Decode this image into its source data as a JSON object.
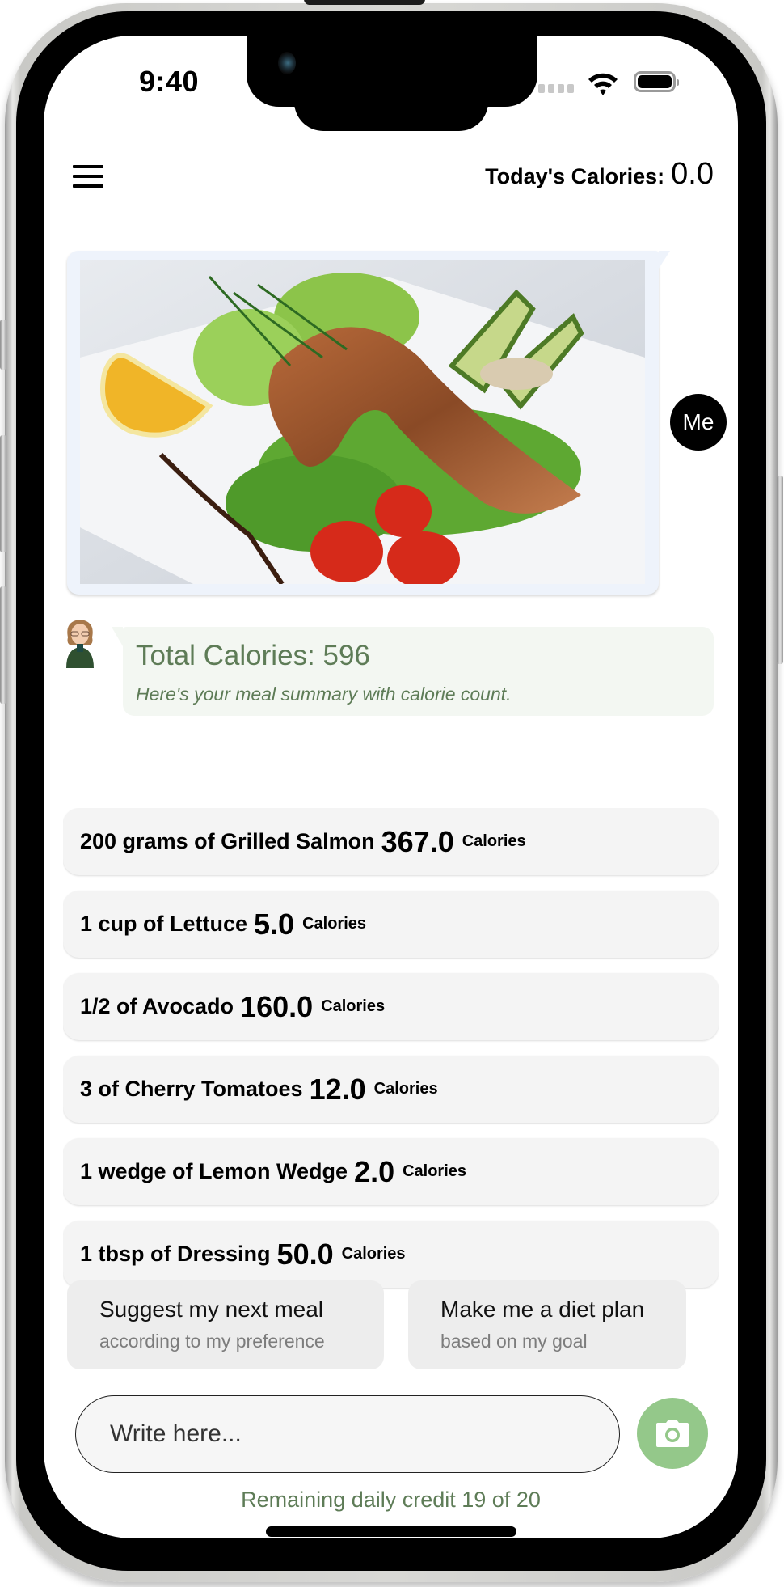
{
  "status_bar": {
    "time": "9:40"
  },
  "header": {
    "menu_icon": "hamburger-icon",
    "today_calories_label": "Today's Calories:",
    "today_calories_value": "0.0"
  },
  "chat": {
    "user_message": {
      "avatar_label": "Me",
      "image_alt": "Grilled salmon steak with lettuce, avocado, cherry tomatoes, lemon wedge and dressing"
    },
    "bot_message": {
      "title": "Total Calories: 596",
      "subtitle": "Here's your meal summary with calorie count."
    }
  },
  "food_items": [
    {
      "description": "200 grams of Grilled Salmon",
      "calories": "367.0",
      "unit": "Calories"
    },
    {
      "description": "1 cup of Lettuce",
      "calories": "5.0",
      "unit": "Calories"
    },
    {
      "description": "1/2 of Avocado",
      "calories": "160.0",
      "unit": "Calories"
    },
    {
      "description": "3 of Cherry Tomatoes",
      "calories": "12.0",
      "unit": "Calories"
    },
    {
      "description": "1 wedge of Lemon Wedge",
      "calories": "2.0",
      "unit": "Calories"
    },
    {
      "description": "1 tbsp of Dressing",
      "calories": "50.0",
      "unit": "Calories"
    }
  ],
  "suggestions": [
    {
      "title": "Suggest my next meal",
      "subtitle": "according to my preference"
    },
    {
      "title": "Make me a diet plan",
      "subtitle": "based on my goal"
    }
  ],
  "composer": {
    "placeholder": "Write here...",
    "camera_icon": "camera-icon"
  },
  "footer": {
    "credit_text": "Remaining daily credit 19 of 20"
  },
  "colors": {
    "accent_green": "#94c88a",
    "text_green": "#5e7c57",
    "bot_bubble": "#f3f7f2",
    "user_bubble": "#eef3fb",
    "card_bg": "#f4f4f4"
  }
}
